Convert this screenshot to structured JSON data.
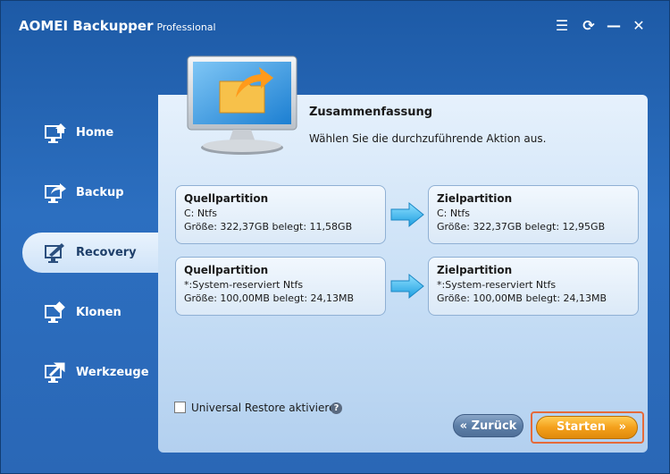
{
  "window": {
    "app_name": "AOMEI Backupper",
    "edition": "Professional",
    "controls": {
      "menu": "☰",
      "refresh": "⟳",
      "minimize": "—",
      "close": "✕"
    }
  },
  "nav": {
    "items": [
      {
        "label": "Home",
        "icon": "home-icon"
      },
      {
        "label": "Backup",
        "icon": "backup-icon"
      },
      {
        "label": "Recovery",
        "icon": "recovery-icon",
        "active": true
      },
      {
        "label": "Klonen",
        "icon": "clone-icon"
      },
      {
        "label": "Werkzeuge",
        "icon": "tools-icon"
      }
    ]
  },
  "summary": {
    "title": "Zusammenfassung",
    "subtitle": "Wählen Sie die durchzuführende Aktion aus."
  },
  "partitions": [
    {
      "source": {
        "header": "Quellpartition",
        "name": "C: Ntfs",
        "size": "Größe: 322,37GB  belegt: 11,58GB"
      },
      "target": {
        "header": "Zielpartition",
        "name": "C: Ntfs",
        "size": "Größe: 322,37GB  belegt: 12,95GB"
      }
    },
    {
      "source": {
        "header": "Quellpartition",
        "name": "*:System-reserviert Ntfs",
        "size": "Größe: 100,00MB  belegt: 24,13MB"
      },
      "target": {
        "header": "Zielpartition",
        "name": "*:System-reserviert Ntfs",
        "size": "Größe: 100,00MB  belegt: 24,13MB"
      }
    }
  ],
  "universal_restore": {
    "label": "Universal Restore aktivieren",
    "checked": false,
    "help": "?"
  },
  "buttons": {
    "back_icon": "«",
    "back": "Zurück",
    "start": "Starten",
    "start_icon": "»"
  },
  "colors": {
    "accent": "#2c6fc0",
    "panel": "#d5e6f8",
    "start": "#f4a01c",
    "highlight": "#e56a3a"
  }
}
